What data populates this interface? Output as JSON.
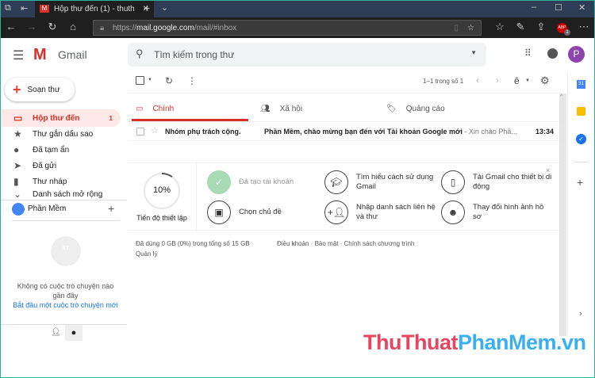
{
  "browser": {
    "tab_title": "Hộp thư đến (1) - thuth",
    "url_prefix": "https://",
    "url_host": "mail.google.com",
    "url_path": "/mail/#inbox",
    "abp_badge": "1"
  },
  "gmail": {
    "logo": "Gmail",
    "search_placeholder": "Tìm kiếm trong thư",
    "avatar_letter": "P",
    "compose": "Soạn thư"
  },
  "sidebar": {
    "items": [
      {
        "label": "Hộp thư đến",
        "count": "1"
      },
      {
        "label": "Thư gắn dấu sao"
      },
      {
        "label": "Đã tạm ẩn"
      },
      {
        "label": "Đã gửi"
      },
      {
        "label": "Thư nháp"
      },
      {
        "label": "Danh sách mở rộng"
      }
    ],
    "hangouts_user": "Phần Mềm",
    "no_chats": "Không có cuộc trò chuyện nào gần đây",
    "start_chat": "Bắt đầu một cuộc trò chuyện mới"
  },
  "toolbar": {
    "pagination": "1–1 trong số 1",
    "input_tool": "ê"
  },
  "tabs": [
    {
      "label": "Chính"
    },
    {
      "label": "Xã hội"
    },
    {
      "label": "Quảng cáo"
    }
  ],
  "emails": [
    {
      "sender": "Nhóm phụ trách cộng.",
      "subject": "Phần Mềm, chào mừng bạn đến với Tài khoản Google mới",
      "snippet": " - Xin chào Phầ...",
      "time": "13:34"
    }
  ],
  "setup": {
    "progress_percent": 10,
    "progress_label": "10%",
    "title": "Tiến độ thiết lập",
    "items": [
      "Đã tạo tài khoản",
      "Tìm hiểu cách sử dụng Gmail",
      "Tải Gmail cho thiết bị di động",
      "Chọn chủ đề",
      "Nhập danh sách liên hệ và thư",
      "Thay đổi hình ảnh hồ sơ"
    ]
  },
  "footer": {
    "storage": "Đã dùng 0 GB (0%) trong tổng số 15 GB",
    "manage": "Quản lý",
    "links": "Điều khoản · Bảo mật · Chính sách chương trình"
  },
  "watermark": {
    "part1": "ThuThuat",
    "part2": "PhanMem.vn"
  }
}
